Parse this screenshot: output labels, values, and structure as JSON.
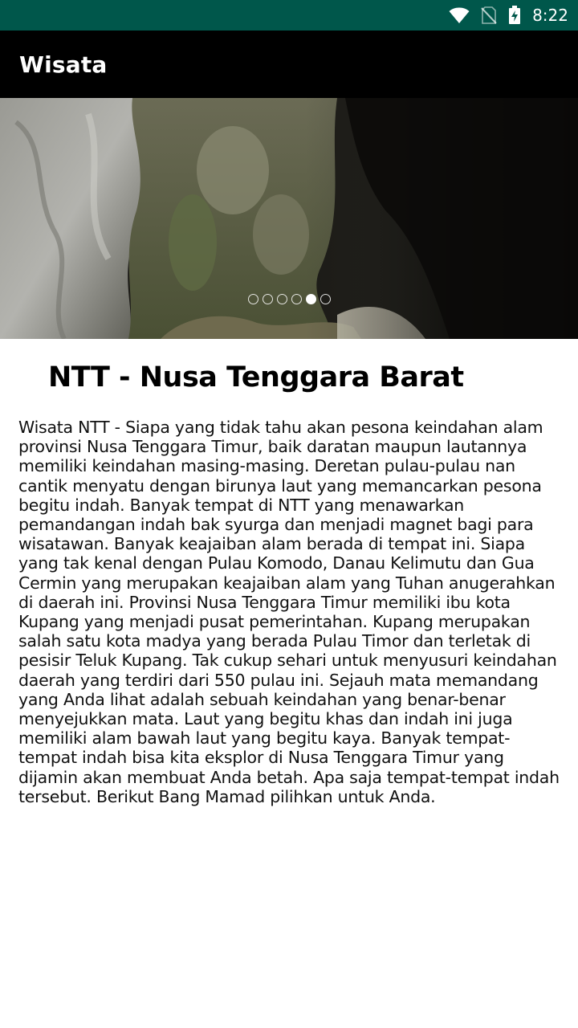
{
  "status_bar": {
    "time": "8:22",
    "icons": [
      "wifi-icon",
      "no-sim-icon",
      "battery-charging-icon"
    ],
    "background": "#00574b"
  },
  "app_bar": {
    "title": "Wisata",
    "background": "#000000"
  },
  "carousel": {
    "slide_count": 6,
    "active_index": 4
  },
  "content": {
    "heading": "NTT - Nusa Tenggara Barat",
    "description": "Wisata NTT - Siapa yang tidak tahu akan pesona keindahan alam provinsi Nusa Tenggara Timur, baik daratan maupun lautannya memiliki keindahan masing-masing. Deretan pulau-pulau nan cantik menyatu dengan birunya laut yang memancarkan pesona begitu indah. Banyak tempat di NTT yang menawarkan pemandangan indah bak syurga dan menjadi magnet bagi para wisatawan. Banyak keajaiban alam berada di tempat ini. Siapa yang tak kenal dengan Pulau Komodo, Danau Kelimutu dan Gua Cermin yang merupakan keajaiban alam yang Tuhan anugerahkan di daerah ini. Provinsi Nusa Tenggara Timur memiliki ibu kota Kupang yang menjadi pusat pemerintahan. Kupang merupakan salah satu kota madya yang berada Pulau Timor dan terletak di pesisir Teluk Kupang. Tak cukup sehari untuk menyusuri keindahan daerah yang terdiri dari 550 pulau ini. Sejauh mata memandang yang Anda lihat adalah sebuah keindahan yang benar-benar menyejukkan mata. Laut yang begitu khas dan indah ini juga memiliki alam bawah laut yang begitu kaya. Banyak tempat-tempat indah bisa kita eksplor di Nusa Tenggara Timur yang dijamin akan membuat Anda betah. Apa saja tempat-tempat indah tersebut. Berikut Bang Mamad pilihkan untuk Anda."
  }
}
